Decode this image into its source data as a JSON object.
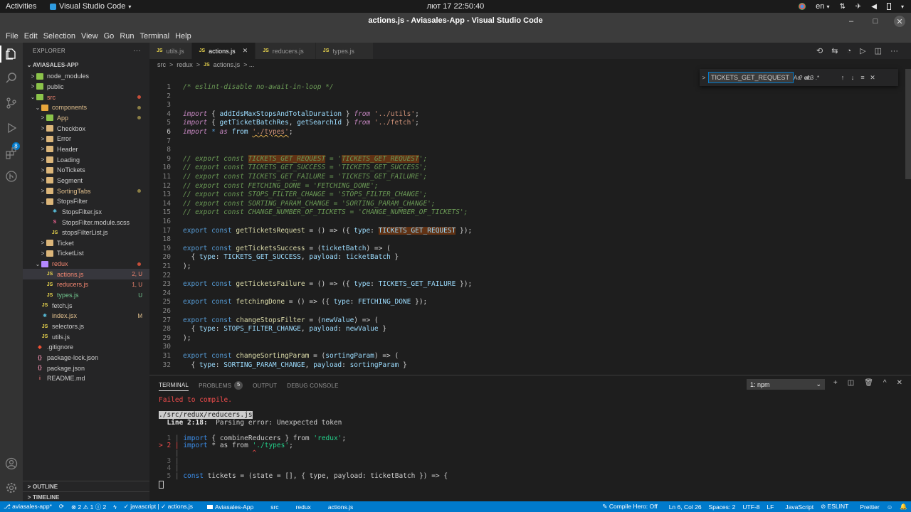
{
  "gnome": {
    "activities": "Activities",
    "app_name": "Visual Studio Code",
    "app_caret": "▾",
    "clock": "лют 17  22:50:40",
    "lang": "en",
    "lang_caret": "▾",
    "power_caret": "▾"
  },
  "window": {
    "title": "actions.js - Aviasales-App - Visual Studio Code"
  },
  "menu": [
    "File",
    "Edit",
    "Selection",
    "View",
    "Go",
    "Run",
    "Terminal",
    "Help"
  ],
  "sidebar": {
    "title": "EXPLORER",
    "more": "···",
    "project": "AVIASALES-APP",
    "tree": [
      {
        "label": "node_modules",
        "chev": ">",
        "icon": "folder-green",
        "indent": 1
      },
      {
        "label": "public",
        "chev": ">",
        "icon": "folder-green",
        "indent": 1
      },
      {
        "label": "src",
        "chev": "⌄",
        "icon": "folder-green",
        "indent": 1,
        "style": "err",
        "dot": "#c74e39"
      },
      {
        "label": "components",
        "chev": "⌄",
        "icon": "folder-orange",
        "indent": 2,
        "style": "mod",
        "dot": "#8b7e45"
      },
      {
        "label": "App",
        "chev": ">",
        "icon": "folder-green",
        "indent": 3,
        "style": "mod",
        "dot": "#8b7e45"
      },
      {
        "label": "Checkbox",
        "chev": ">",
        "icon": "folder",
        "indent": 3
      },
      {
        "label": "Error",
        "chev": ">",
        "icon": "folder",
        "indent": 3
      },
      {
        "label": "Header",
        "chev": ">",
        "icon": "folder",
        "indent": 3
      },
      {
        "label": "Loading",
        "chev": ">",
        "icon": "folder",
        "indent": 3
      },
      {
        "label": "NoTickets",
        "chev": ">",
        "icon": "folder",
        "indent": 3
      },
      {
        "label": "Segment",
        "chev": ">",
        "icon": "folder",
        "indent": 3
      },
      {
        "label": "SortingTabs",
        "chev": ">",
        "icon": "folder",
        "indent": 3,
        "style": "mod",
        "dot": "#8b7e45"
      },
      {
        "label": "StopsFilter",
        "chev": "⌄",
        "icon": "folder",
        "indent": 3
      },
      {
        "label": "StopsFilter.jsx",
        "chev": "",
        "icon": "jsx",
        "indent": 4
      },
      {
        "label": "StopsFilter.module.scss",
        "chev": "",
        "icon": "scss",
        "indent": 4
      },
      {
        "label": "stopsFilterList.js",
        "chev": "",
        "icon": "js",
        "indent": 4
      },
      {
        "label": "Ticket",
        "chev": ">",
        "icon": "folder",
        "indent": 3
      },
      {
        "label": "TicketList",
        "chev": ">",
        "icon": "folder",
        "indent": 3
      },
      {
        "label": "redux",
        "chev": "⌄",
        "icon": "folder-purple",
        "indent": 2,
        "style": "err",
        "dot": "#c74e39"
      },
      {
        "label": "actions.js",
        "chev": "",
        "icon": "js",
        "indent": 3,
        "style": "err",
        "deco": "2, U",
        "deco_color": "#f48771",
        "selected": true
      },
      {
        "label": "reducers.js",
        "chev": "",
        "icon": "js",
        "indent": 3,
        "style": "err",
        "deco": "1, U",
        "deco_color": "#f48771"
      },
      {
        "label": "types.js",
        "chev": "",
        "icon": "js",
        "indent": 3,
        "style": "untracked",
        "deco": "U",
        "deco_color": "#73c991"
      },
      {
        "label": "fetch.js",
        "chev": "",
        "icon": "js",
        "indent": 2
      },
      {
        "label": "index.jsx",
        "chev": "",
        "icon": "jsx",
        "indent": 2,
        "style": "mod",
        "deco": "M",
        "deco_color": "#e2c08d"
      },
      {
        "label": "selectors.js",
        "chev": "",
        "icon": "js",
        "indent": 2
      },
      {
        "label": "utils.js",
        "chev": "",
        "icon": "js",
        "indent": 2
      },
      {
        "label": ".gitignore",
        "chev": "",
        "icon": "git",
        "indent": 1
      },
      {
        "label": "package-lock.json",
        "chev": "",
        "icon": "json",
        "indent": 1
      },
      {
        "label": "package.json",
        "chev": "",
        "icon": "json",
        "indent": 1
      },
      {
        "label": "README.md",
        "chev": "",
        "icon": "md",
        "indent": 1
      }
    ],
    "outline": "OUTLINE",
    "timeline": "TIMELINE"
  },
  "tabs": [
    {
      "badge": "JS",
      "label": "utils.js",
      "active": false
    },
    {
      "badge": "JS",
      "label": "actions.js",
      "active": true,
      "close": "✕"
    },
    {
      "badge": "JS",
      "label": "reducers.js",
      "active": false
    },
    {
      "badge": "JS",
      "label": "types.js",
      "active": false
    }
  ],
  "breadcrumb": {
    "parts": [
      "src",
      ">",
      "redux",
      ">"
    ],
    "file_badge": "JS",
    "file": "actions.js",
    "tail": "> ..."
  },
  "find": {
    "toggle": ">",
    "value": "TICKETS_GET_REQUEST",
    "opts": [
      "Aa",
      "ab",
      ".*"
    ],
    "count": "? of 3",
    "prev": "↑",
    "next": "↓",
    "sel": "≡",
    "close": "✕"
  },
  "code": [
    {
      "n": "1",
      "segs": [
        [
          "cm",
          "/* eslint-disable no-await-in-loop */"
        ]
      ]
    },
    {
      "n": "2",
      "segs": []
    },
    {
      "n": "3",
      "segs": []
    },
    {
      "n": "4",
      "segs": [
        [
          "kw",
          "import"
        ],
        [
          "",
          " { "
        ],
        [
          "var",
          "addIdsMaxStopsAndTotalDuration"
        ],
        [
          "",
          " } "
        ],
        [
          "kw",
          "from"
        ],
        [
          "",
          " "
        ],
        [
          "str",
          "'../utils'"
        ],
        [
          "",
          ";"
        ]
      ]
    },
    {
      "n": "5",
      "segs": [
        [
          "kw",
          "import"
        ],
        [
          "",
          " { "
        ],
        [
          "var",
          "getTicketBatchRes"
        ],
        [
          "",
          ", "
        ],
        [
          "var",
          "getSearchId"
        ],
        [
          "",
          " } "
        ],
        [
          "kw",
          "from"
        ],
        [
          "",
          " "
        ],
        [
          "str",
          "'../fetch'"
        ],
        [
          "",
          ";"
        ]
      ]
    },
    {
      "n": "6",
      "segs": [
        [
          "kw",
          "import"
        ],
        [
          "",
          " "
        ],
        [
          "ctrl",
          "*"
        ],
        [
          "",
          " "
        ],
        [
          "kw",
          "as"
        ],
        [
          "",
          " "
        ],
        [
          "var",
          "from"
        ],
        [
          "",
          " "
        ],
        [
          "str squig",
          "'./types'"
        ],
        [
          "",
          ";"
        ]
      ],
      "cur": true
    },
    {
      "n": "7",
      "segs": []
    },
    {
      "n": "8",
      "segs": []
    },
    {
      "n": "9",
      "segs": [
        [
          "cm",
          "// export const "
        ],
        [
          "cm hl",
          "TICKETS_GET_REQUEST"
        ],
        [
          "cm",
          " = '"
        ],
        [
          "cm hl",
          "TICKETS_GET_REQUEST"
        ],
        [
          "cm",
          "';"
        ]
      ]
    },
    {
      "n": "10",
      "segs": [
        [
          "cm",
          "// export const TICKETS_GET_SUCCESS = 'TICKETS_GET_SUCCESS';"
        ]
      ]
    },
    {
      "n": "11",
      "segs": [
        [
          "cm",
          "// export const TICKETS_GET_FAILURE = 'TICKETS_GET_FAILURE';"
        ]
      ]
    },
    {
      "n": "12",
      "segs": [
        [
          "cm",
          "// export const FETCHING_DONE = 'FETCHING_DONE';"
        ]
      ]
    },
    {
      "n": "13",
      "segs": [
        [
          "cm",
          "// export const STOPS_FILTER_CHANGE = 'STOPS_FILTER_CHANGE';"
        ]
      ]
    },
    {
      "n": "14",
      "segs": [
        [
          "cm",
          "// export const SORTING_PARAM_CHANGE = 'SORTING_PARAM_CHANGE';"
        ]
      ]
    },
    {
      "n": "15",
      "segs": [
        [
          "cm",
          "// export const CHANGE_NUMBER_OF_TICKETS = 'CHANGE_NUMBER_OF_TICKETS';"
        ]
      ]
    },
    {
      "n": "16",
      "segs": []
    },
    {
      "n": "17",
      "segs": [
        [
          "ctrl",
          "export"
        ],
        [
          "",
          " "
        ],
        [
          "ctrl",
          "const"
        ],
        [
          "",
          " "
        ],
        [
          "fn",
          "getTicketsRequest"
        ],
        [
          "",
          " = () => ({ "
        ],
        [
          "var",
          "type"
        ],
        [
          "",
          ": "
        ],
        [
          "var hl",
          "TICKETS_GET_REQUEST"
        ],
        [
          "",
          " });"
        ]
      ]
    },
    {
      "n": "18",
      "segs": []
    },
    {
      "n": "19",
      "segs": [
        [
          "ctrl",
          "export"
        ],
        [
          "",
          " "
        ],
        [
          "ctrl",
          "const"
        ],
        [
          "",
          " "
        ],
        [
          "fn",
          "getTicketsSuccess"
        ],
        [
          "",
          " = ("
        ],
        [
          "var",
          "ticketBatch"
        ],
        [
          "",
          ") => ("
        ]
      ]
    },
    {
      "n": "20",
      "segs": [
        [
          "",
          "  { "
        ],
        [
          "var",
          "type"
        ],
        [
          "",
          ": "
        ],
        [
          "var",
          "TICKETS_GET_SUCCESS"
        ],
        [
          "",
          ", "
        ],
        [
          "var",
          "payload"
        ],
        [
          "",
          ": "
        ],
        [
          "var",
          "ticketBatch"
        ],
        [
          "",
          " }"
        ]
      ]
    },
    {
      "n": "21",
      "segs": [
        [
          "",
          ");"
        ]
      ]
    },
    {
      "n": "22",
      "segs": []
    },
    {
      "n": "23",
      "segs": [
        [
          "ctrl",
          "export"
        ],
        [
          "",
          " "
        ],
        [
          "ctrl",
          "const"
        ],
        [
          "",
          " "
        ],
        [
          "fn",
          "getTicketsFailure"
        ],
        [
          "",
          " = () => ({ "
        ],
        [
          "var",
          "type"
        ],
        [
          "",
          ": "
        ],
        [
          "var",
          "TICKETS_GET_FAILURE"
        ],
        [
          "",
          " });"
        ]
      ]
    },
    {
      "n": "24",
      "segs": []
    },
    {
      "n": "25",
      "segs": [
        [
          "ctrl",
          "export"
        ],
        [
          "",
          " "
        ],
        [
          "ctrl",
          "const"
        ],
        [
          "",
          " "
        ],
        [
          "fn",
          "fetchingDone"
        ],
        [
          "",
          " = () => ({ "
        ],
        [
          "var",
          "type"
        ],
        [
          "",
          ": "
        ],
        [
          "var",
          "FETCHING_DONE"
        ],
        [
          "",
          " });"
        ]
      ]
    },
    {
      "n": "26",
      "segs": []
    },
    {
      "n": "27",
      "segs": [
        [
          "ctrl",
          "export"
        ],
        [
          "",
          " "
        ],
        [
          "ctrl",
          "const"
        ],
        [
          "",
          " "
        ],
        [
          "fn",
          "changeStopsFilter"
        ],
        [
          "",
          " = ("
        ],
        [
          "var",
          "newValue"
        ],
        [
          "",
          ") => ("
        ]
      ]
    },
    {
      "n": "28",
      "segs": [
        [
          "",
          "  { "
        ],
        [
          "var",
          "type"
        ],
        [
          "",
          ": "
        ],
        [
          "var",
          "STOPS_FILTER_CHANGE"
        ],
        [
          "",
          ", "
        ],
        [
          "var",
          "payload"
        ],
        [
          "",
          ": "
        ],
        [
          "var",
          "newValue"
        ],
        [
          "",
          " }"
        ]
      ]
    },
    {
      "n": "29",
      "segs": [
        [
          "",
          ");"
        ]
      ]
    },
    {
      "n": "30",
      "segs": []
    },
    {
      "n": "31",
      "segs": [
        [
          "ctrl",
          "export"
        ],
        [
          "",
          " "
        ],
        [
          "ctrl",
          "const"
        ],
        [
          "",
          " "
        ],
        [
          "fn",
          "changeSortingParam"
        ],
        [
          "",
          " = ("
        ],
        [
          "var",
          "sortingParam"
        ],
        [
          "",
          ") => ("
        ]
      ]
    },
    {
      "n": "32",
      "segs": [
        [
          "",
          "  { "
        ],
        [
          "var",
          "type"
        ],
        [
          "",
          ": "
        ],
        [
          "var",
          "SORTING_PARAM_CHANGE"
        ],
        [
          "",
          ", "
        ],
        [
          "var",
          "payload"
        ],
        [
          "",
          ": "
        ],
        [
          "var",
          "sortingParam"
        ],
        [
          "",
          " }"
        ]
      ]
    }
  ],
  "panel": {
    "tabs": [
      {
        "label": "TERMINAL",
        "active": true
      },
      {
        "label": "PROBLEMS",
        "badge": "5"
      },
      {
        "label": "OUTPUT"
      },
      {
        "label": "DEBUG CONSOLE"
      }
    ],
    "terminal_select": "1: npm",
    "select_caret": "⌄",
    "actions": [
      "+",
      "◫",
      "🗑",
      "^",
      "✕"
    ],
    "lines": [
      [
        [
          "t-red",
          "Failed to compile."
        ]
      ],
      [],
      [
        [
          "t-inv",
          "./src/redux/reducers.js"
        ]
      ],
      [
        [
          "t-bold",
          "  Line 2:18:"
        ],
        [
          "",
          "  Parsing error: Unexpected token"
        ]
      ],
      [],
      [
        [
          "t-gray",
          "  1 | "
        ],
        [
          "t-blue",
          "import"
        ],
        [
          "",
          " { combineReducers } "
        ],
        [
          "",
          "from"
        ],
        [
          "",
          " "
        ],
        [
          "t-green",
          "'redux'"
        ],
        [
          "",
          ";"
        ]
      ],
      [
        [
          "t-red",
          "> 2 | "
        ],
        [
          "t-blue",
          "import"
        ],
        [
          "",
          " * as from "
        ],
        [
          "t-green",
          "'./types'"
        ],
        [
          "",
          ";"
        ]
      ],
      [
        [
          "t-gray",
          "    | "
        ],
        [
          "t-red",
          "                 ^"
        ]
      ],
      [
        [
          "t-gray",
          "  3 |"
        ]
      ],
      [
        [
          "t-gray",
          "  4 |"
        ]
      ],
      [
        [
          "t-gray",
          "  5 | "
        ],
        [
          "t-blue",
          "const"
        ],
        [
          "",
          " tickets = (state = [], { type, payload: ticketBatch }) => {"
        ]
      ]
    ]
  },
  "status": {
    "left": [
      "⎇ aviasales-app*",
      "⟳",
      "⊗ 2 ⚠ 1 ⓘ 2",
      "ϟ",
      "✓ javascript | ✓ actions.js",
      "",
      "Aviasales-App",
      "src",
      "redux",
      "actions.js"
    ],
    "right": [
      "✎ Compile Hero: Off",
      "Ln 6, Col 26",
      "Spaces: 2",
      "UTF-8",
      "LF",
      "JavaScript",
      "⊘ ESLINT",
      "Prettier",
      "☺",
      "🔔"
    ]
  }
}
